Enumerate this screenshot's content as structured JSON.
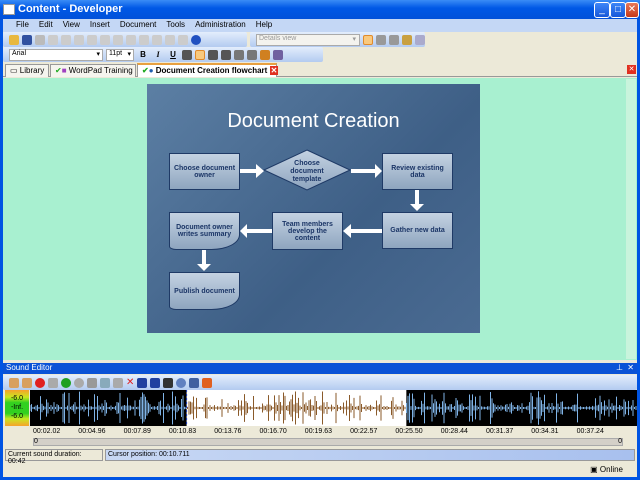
{
  "window": {
    "title": "Content - Developer"
  },
  "menu": [
    "File",
    "Edit",
    "View",
    "Insert",
    "Document",
    "Tools",
    "Administration",
    "Help"
  ],
  "toolbar": {
    "view_select": "Details view",
    "font": "Arial",
    "size": "11pt",
    "bold": "B",
    "italic": "I",
    "underline": "U"
  },
  "tabs": [
    {
      "label": "Library"
    },
    {
      "label": "WordPad Training"
    },
    {
      "label": "Document Creation flowchart",
      "active": true
    }
  ],
  "slide": {
    "title": "Document Creation",
    "nodes": {
      "owner": "Choose document owner",
      "template": "Choose document template",
      "review": "Review existing data",
      "gather": "Gather new data",
      "team": "Team members develop the content",
      "summary": "Document owner writes summary",
      "publish": "Publish document"
    }
  },
  "sound_editor": {
    "title": "Sound Editor",
    "meter": [
      "-6.0",
      "-Inf.",
      "-6.0"
    ],
    "ticks": [
      "00:02.02",
      "00:04.96",
      "00:07.89",
      "00:10.83",
      "00:13.76",
      "00:16.70",
      "00:19.63",
      "00:22.57",
      "00:25.50",
      "00:28.44",
      "00:31.37",
      "00:34.31",
      "00:37.24"
    ],
    "scroll_start": "0",
    "scroll_end": "0",
    "duration": "Current sound duration: 00:42",
    "cursor": "Cursor position: 00:10.711",
    "selection_start_fraction": 0.258,
    "selection_end_fraction": 0.62
  },
  "status": {
    "online": "Online"
  },
  "colors": {
    "wave_bg": "#000000",
    "wave_fg": "#7fb3e6",
    "sel_bg": "#ffffff",
    "sel_fg": "#8a5a2a"
  }
}
